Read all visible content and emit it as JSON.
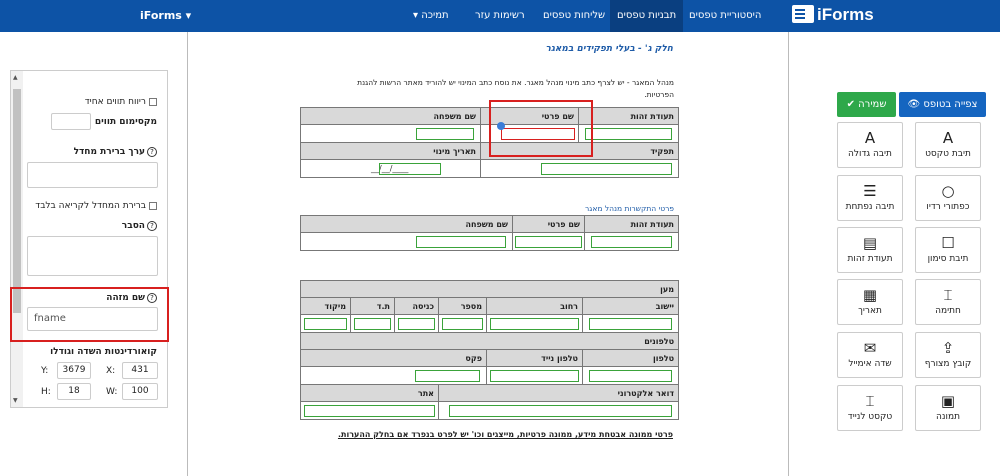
{
  "topbar": {
    "brand_left": "iForms ▾",
    "brand_right": "iForms",
    "nav": [
      {
        "label": "היסטוריית טפסים"
      },
      {
        "label": "תבניות טפסים"
      },
      {
        "label": "שליחות טפסים"
      },
      {
        "label": "רשימות עזר"
      },
      {
        "label": "▾ תמיכה"
      }
    ]
  },
  "left_panel": {
    "unique_spacing_label": "ריווח תווים אחיד",
    "max_chars_label": "מקסימום תווים",
    "default_value_label": "ערך ברירת מחדל",
    "readonly_label": "ברירת המחדל לקריאה בלבד",
    "explanation_label": "הסבר",
    "id_name_label": "שם מזהה",
    "id_name_value": "fname",
    "coords_label": "קואורדינטות השדה וגודלו",
    "coords": {
      "y_label": "Y:",
      "y": "3679",
      "x_label": "X:",
      "x": "431",
      "h_label": "H:",
      "h": "18",
      "w_label": "W:",
      "w": "100"
    }
  },
  "document": {
    "section_title": "חלק ג' - בעלי תפקידים במאגר",
    "intro_line1": "מנהל המאגר - יש לצרף כתב מינוי מנהל מאגר. את נוסח כתב המינוי יש להוריד מאתר הרשות להגנת",
    "intro_line2": "הפרטיות.",
    "t1_headers": [
      "תעודת זהות",
      "שם פרטי",
      "שם משפחה"
    ],
    "t1_row2_headers": [
      "תפקיד",
      "תאריך מינוי"
    ],
    "date_placeholder": "__/__/____",
    "contact_title": "פרטי התקשרות מנהל מאגר",
    "t2_headers": [
      "תעודת זהות",
      "שם פרטי",
      "שם משפחה"
    ],
    "address_title": "מען",
    "address_headers": [
      "יישוב",
      "רחוב",
      "מספר",
      "כניסה",
      "ת.ד",
      "מיקוד"
    ],
    "phones_title": "טלפונים",
    "phone_headers": [
      "טלפון",
      "טלפון נייד",
      "פקס"
    ],
    "email_headers": [
      "דואר אלקטרוני",
      "אתר"
    ],
    "footnote": "פרטי ממונה אבטחת מידע, ממונה פרטיות, מייצגים וכו' יש לפרט בנפרד אם בחלק ההערות."
  },
  "right_panel": {
    "preview_button": "צפייה בטופס",
    "save_button": "שמירה",
    "tools": [
      {
        "label": "תיבת טקסט",
        "icon": "text-icon"
      },
      {
        "label": "תיבה גדולה",
        "icon": "large-text-icon"
      },
      {
        "label": "כפתורי רדיו",
        "icon": "radio-icon"
      },
      {
        "label": "תיבה נפתחת",
        "icon": "dropdown-icon"
      },
      {
        "label": "תיבת סימון",
        "icon": "checkbox-icon"
      },
      {
        "label": "תעודת זהות",
        "icon": "id-card-icon"
      },
      {
        "label": "חתימה",
        "icon": "signature-icon"
      },
      {
        "label": "תאריך",
        "icon": "calendar-icon"
      },
      {
        "label": "קובץ מצורף",
        "icon": "upload-icon"
      },
      {
        "label": "שדה אימייל",
        "icon": "email-icon"
      },
      {
        "label": "תמונה",
        "icon": "image-icon"
      },
      {
        "label": "טקסט לנייד",
        "icon": "mobile-text-icon"
      }
    ]
  },
  "colors": {
    "topbar": "#0d53a6",
    "active_nav": "#0a3f80",
    "preview": "#1565c0",
    "save": "#2ea84a",
    "highlight": "#d8201f",
    "field_border": "#3aa33a"
  }
}
